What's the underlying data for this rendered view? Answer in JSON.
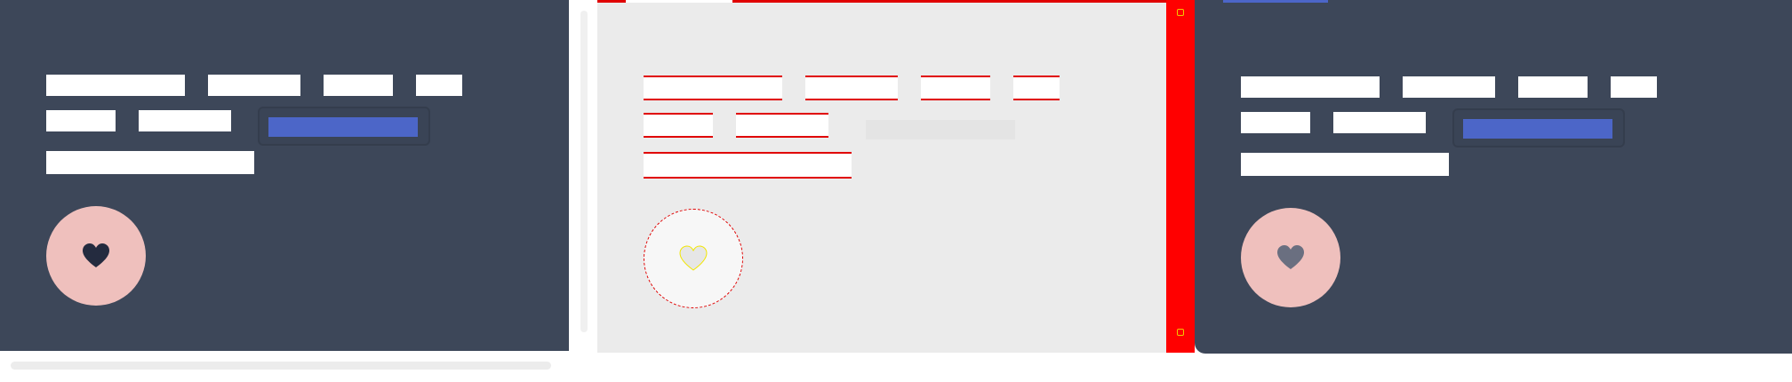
{
  "panels": {
    "left": {
      "background": "#3d4759",
      "accent": "#4c66c8",
      "heart_button_color": "#efc0bd",
      "heart_icon": "heart-icon",
      "heart_icon_color": "#242b3f"
    },
    "middle": {
      "background": "#ebebeb",
      "outline_color": "#e00000",
      "heart_icon": "heart-icon",
      "heart_icon_color": "#e6e6e6"
    },
    "right": {
      "background": "#3d4759",
      "accent": "#4c66c8",
      "heart_button_color": "#efc0bd",
      "heart_icon": "heart-icon",
      "heart_icon_color": "#6a6f80"
    }
  },
  "scrollbars": {
    "horizontal": "scrollbar",
    "vertical": "scrollbar"
  }
}
